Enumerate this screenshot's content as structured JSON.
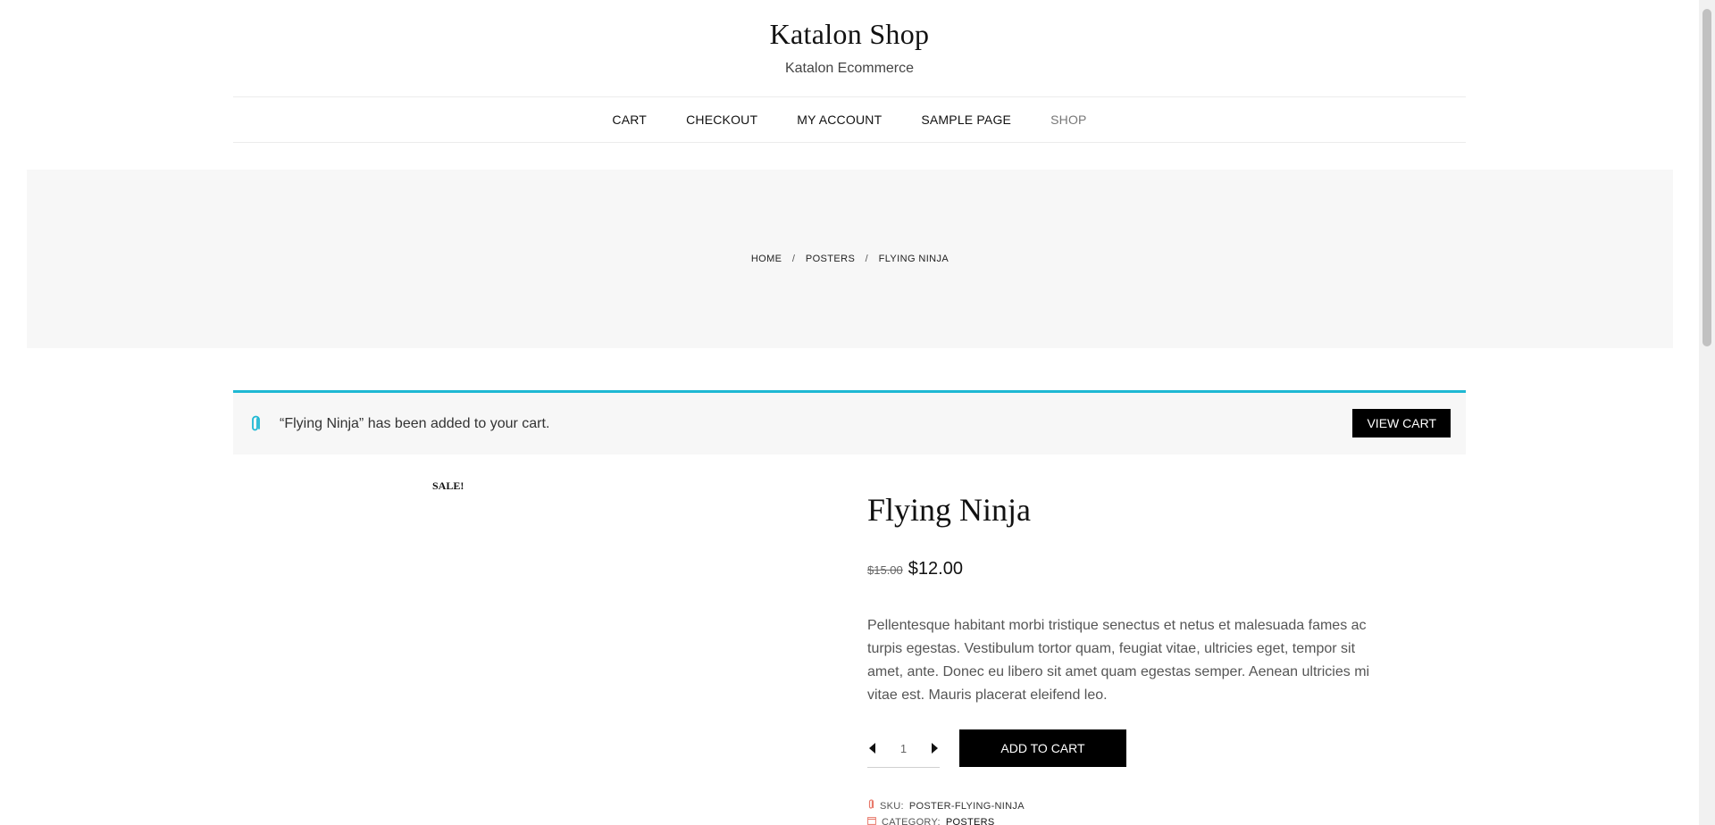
{
  "site": {
    "title": "Katalon Shop",
    "tagline": "Katalon Ecommerce"
  },
  "nav": {
    "items": [
      {
        "label": "CART",
        "current": false
      },
      {
        "label": "CHECKOUT",
        "current": false
      },
      {
        "label": "MY ACCOUNT",
        "current": false
      },
      {
        "label": "SAMPLE PAGE",
        "current": false
      },
      {
        "label": "SHOP",
        "current": true
      }
    ]
  },
  "breadcrumb": {
    "home": "HOME",
    "category": "POSTERS",
    "current": "FLYING NINJA",
    "separator": "/"
  },
  "notice": {
    "message": "“Flying Ninja” has been added to your cart.",
    "button_label": "VIEW CART",
    "accent_color": "#1eb8d3",
    "icon": "paperclip-icon"
  },
  "product": {
    "sale_badge": "SALE!",
    "title": "Flying Ninja",
    "old_price": "$15.00",
    "price": "$12.00",
    "description": "Pellentesque habitant morbi tristique senectus et netus et malesuada fames ac turpis egestas. Vestibulum tortor quam, feugiat vitae, ultricies eget, tempor sit amet, ante. Donec eu libero sit amet quam egestas semper. Aenean ultricies mi vitae est. Mauris placerat eleifend leo.",
    "quantity": "1",
    "add_to_cart_label": "ADD TO CART",
    "sku_label": "SKU:",
    "sku_value": "POSTER-FLYING-NINJA",
    "category_label": "CATEGORY:",
    "category_value": "POSTERS",
    "meta_icon_color": "#e8796b"
  }
}
